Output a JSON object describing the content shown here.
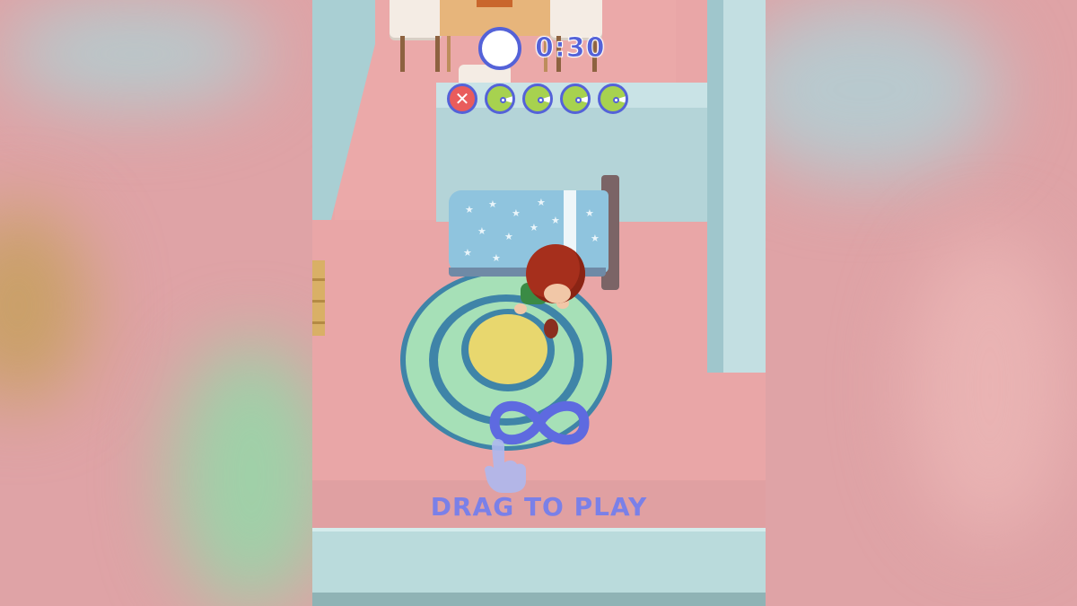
{
  "hud": {
    "timer": "0:30",
    "food_icons": [
      {
        "name": "food-eaten-crossed-icon",
        "state": "crossed"
      },
      {
        "name": "food-pending-icon",
        "state": "pending"
      },
      {
        "name": "food-pending-icon",
        "state": "pending"
      },
      {
        "name": "food-pending-icon",
        "state": "pending"
      },
      {
        "name": "food-pending-icon",
        "state": "pending"
      }
    ]
  },
  "tutorial": {
    "instruction": "DRAG TO PLAY",
    "gesture_icon": "infinity-drag-icon",
    "hand_icon": "pointing-hand-icon"
  },
  "colors": {
    "accent": "#5462d8",
    "instruction_text": "#7a80e8",
    "floor": "#e9a6a7",
    "wall": "#b4d4d8",
    "food_green": "#a7d24f",
    "food_crossed": "#e95c5c"
  }
}
